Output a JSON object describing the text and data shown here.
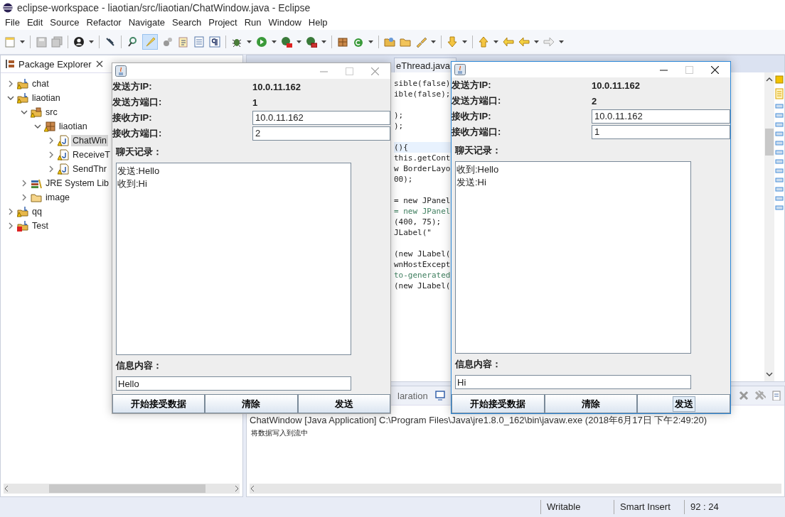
{
  "window": {
    "title": "eclipse-workspace - liaotian/src/liaotian/ChatWindow.java - Eclipse"
  },
  "menu": [
    "File",
    "Edit",
    "Source",
    "Refactor",
    "Navigate",
    "Search",
    "Project",
    "Run",
    "Window",
    "Help"
  ],
  "package_explorer": {
    "title": "Package Explorer",
    "tree": [
      {
        "label": "chat",
        "kind": "project",
        "expanded": false,
        "selected": false
      },
      {
        "label": "liaotian",
        "kind": "project",
        "expanded": true,
        "selected": false,
        "children": [
          {
            "label": "src",
            "kind": "source-folder",
            "expanded": true,
            "selected": false,
            "children": [
              {
                "label": "liaotian",
                "kind": "package",
                "expanded": true,
                "selected": false,
                "children": [
                  {
                    "label": "ChatWin",
                    "kind": "java-file",
                    "expanded": false,
                    "selected": true
                  },
                  {
                    "label": "ReceiveT",
                    "kind": "java-file",
                    "expanded": false,
                    "selected": false
                  },
                  {
                    "label": "SendThr",
                    "kind": "java-file",
                    "expanded": false,
                    "selected": false
                  }
                ]
              }
            ]
          },
          {
            "label": "JRE System Lib",
            "kind": "library",
            "expanded": false,
            "selected": false
          },
          {
            "label": "image",
            "kind": "folder",
            "expanded": false,
            "selected": false
          }
        ]
      },
      {
        "label": "qq",
        "kind": "project",
        "expanded": false,
        "selected": false
      },
      {
        "label": "Test",
        "kind": "error-project",
        "expanded": false,
        "selected": false
      }
    ]
  },
  "editor": {
    "tabs": [
      {
        "label": "eThread.java",
        "selected": false
      }
    ],
    "code_blocks": [
      [
        {
          "text": "sible(false)",
          "kind": "code",
          "current": false
        },
        {
          "text": "ible(false);",
          "kind": "code",
          "current": false
        }
      ],
      [
        {
          "text": ");",
          "kind": "code",
          "current": false
        },
        {
          "text": ");",
          "kind": "code",
          "current": false
        }
      ],
      [
        {
          "text": "(){",
          "kind": "code",
          "current": true
        },
        {
          "text": "this.getCont",
          "kind": "code",
          "current": false
        },
        {
          "text": "w BorderLayo",
          "kind": "code",
          "current": false
        },
        {
          "text": "00);",
          "kind": "code",
          "current": false
        }
      ],
      [
        {
          "text": "= new JPanel",
          "kind": "code",
          "current": false
        },
        {
          "text": "= new JPanel",
          "kind": "comment",
          "current": false
        },
        {
          "text": "(400, 75);",
          "kind": "code",
          "current": false
        },
        {
          "text": "JLabel(\"",
          "kind": "code",
          "current": false
        }
      ],
      [
        {
          "text": "(new JLabel(",
          "kind": "code",
          "current": false
        },
        {
          "text": "wnHostExcept",
          "kind": "code",
          "current": false
        },
        {
          "text": "to-generated",
          "kind": "comment",
          "current": false
        },
        {
          "text": "(new JLabel(",
          "kind": "code",
          "current": false
        }
      ]
    ]
  },
  "console": {
    "tabs": [
      {
        "label": "laration",
        "selected": false
      }
    ],
    "header": "ChatWindow [Java Application] C:\\Program Files\\Java\\jre1.8.0_162\\bin\\javaw.exe (2018年6月17日 下午2:49:20)",
    "output": [
      "将数据写入到流中"
    ]
  },
  "status_bar": [
    "Writable",
    "Smart Insert",
    "92 : 24"
  ],
  "chat_windows": [
    {
      "active": false,
      "fields": [
        {
          "label": "发送方IP:",
          "kind": "text",
          "value": "10.0.11.162"
        },
        {
          "label": "发送方端口:",
          "kind": "text",
          "value": "1"
        },
        {
          "label": "接收方IP:",
          "kind": "input",
          "value": "10.0.11.162"
        },
        {
          "label": "接收方端口:",
          "kind": "input",
          "value": "2"
        }
      ],
      "log_label": "聊天记录：",
      "log": [
        "发送:Hello",
        "收到:Hi"
      ],
      "message_label": "信息内容：",
      "message": "Hello",
      "buttons": [
        {
          "label": "开始接受数据",
          "focused": false
        },
        {
          "label": "清除",
          "focused": false
        },
        {
          "label": "发送",
          "focused": false
        }
      ]
    },
    {
      "active": true,
      "fields": [
        {
          "label": "发送方IP:",
          "kind": "text",
          "value": "10.0.11.162"
        },
        {
          "label": "发送方端口:",
          "kind": "text",
          "value": "2"
        },
        {
          "label": "接收方IP:",
          "kind": "input",
          "value": "10.0.11.162"
        },
        {
          "label": "接收方端口:",
          "kind": "input",
          "value": "1"
        }
      ],
      "log_label": "聊天记录：",
      "log": [
        "收到:Hello",
        "发送:Hi"
      ],
      "message_label": "信息内容：",
      "message": "Hi",
      "buttons": [
        {
          "label": "开始接受数据",
          "focused": false
        },
        {
          "label": "清除",
          "focused": false
        },
        {
          "label": "发送",
          "focused": true
        }
      ]
    }
  ]
}
